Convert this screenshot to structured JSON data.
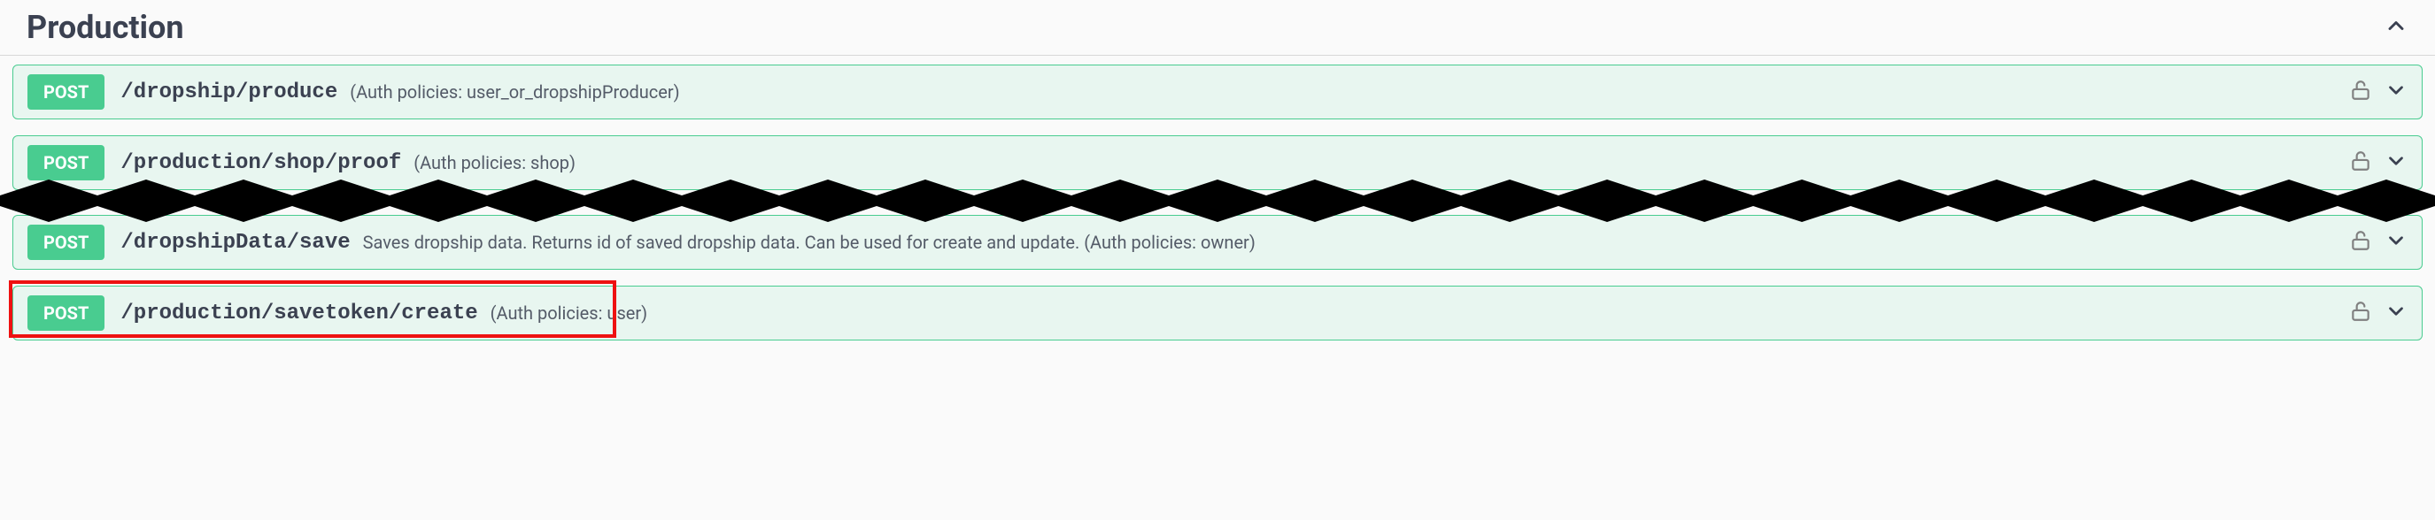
{
  "section": {
    "title": "Production"
  },
  "endpoints": [
    {
      "method": "POST",
      "path": "/dropship/produce",
      "description": "(Auth policies: user_or_dropshipProducer)"
    },
    {
      "method": "POST",
      "path": "/production/shop/proof",
      "description": "(Auth policies: shop)"
    },
    {
      "method": "POST",
      "path": "/dropshipData/save",
      "description": "Saves dropship data. Returns id of saved dropship data. Can be used for create and update. (Auth policies: owner)"
    },
    {
      "method": "POST",
      "path": "/production/savetoken/create",
      "description": "(Auth policies: user)"
    }
  ]
}
